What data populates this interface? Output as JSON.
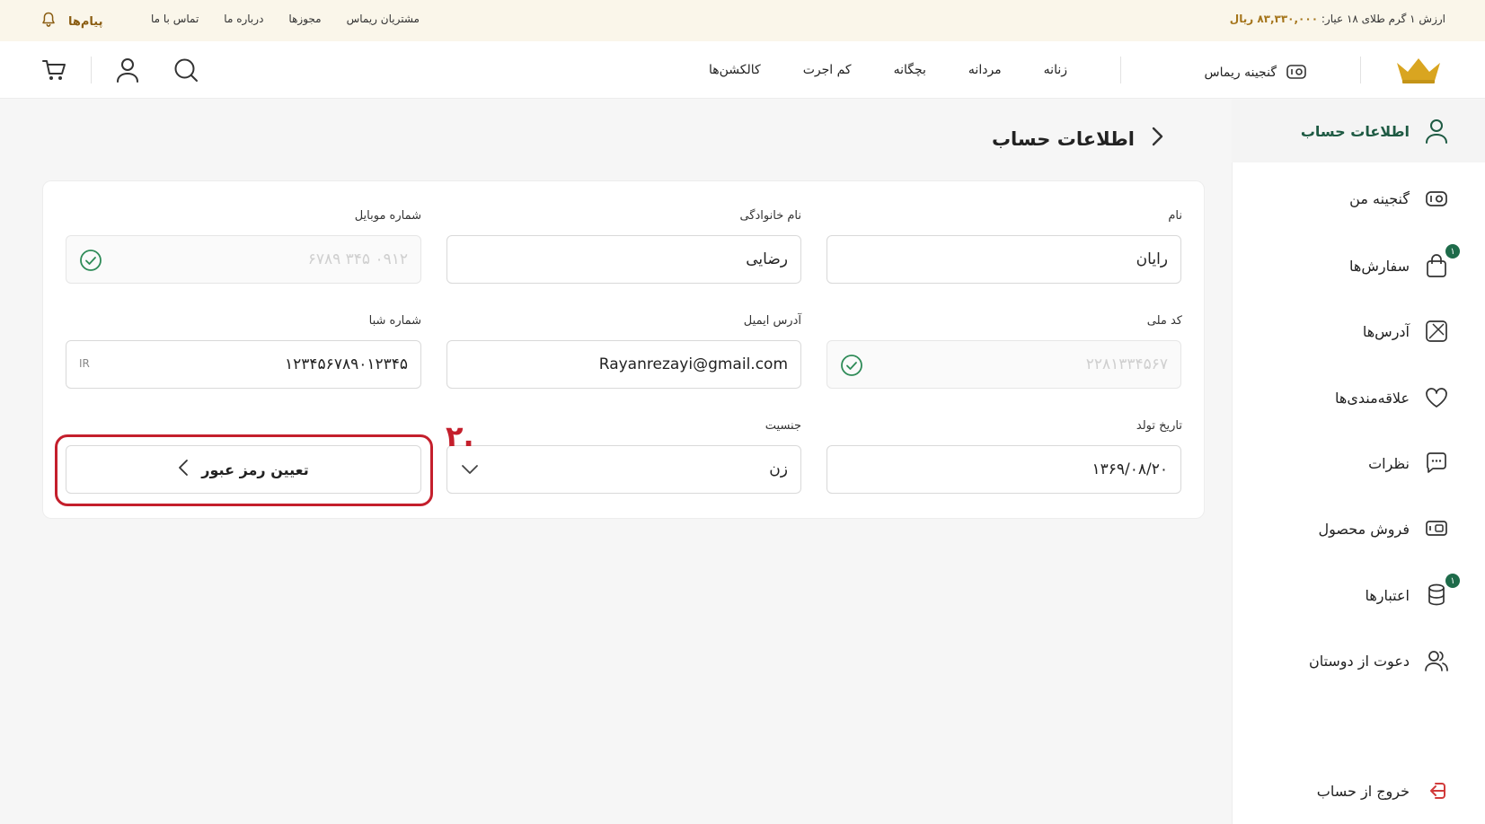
{
  "topbar": {
    "gold_label": "ارزش ۱ گرم طلای ۱۸ عیار:",
    "gold_value": "۸۳,۳۳۰,۰۰۰ ریال",
    "links": [
      "مشتریان ریماس",
      "مجوزها",
      "درباره ما",
      "تماس با ما"
    ],
    "messages_label": "پیام‌ها"
  },
  "header": {
    "brand_link": "گنجینه ریماس",
    "nav": [
      "زنانه",
      "مردانه",
      "بچگانه",
      "کم اجرت",
      "کالکشن‌ها"
    ]
  },
  "sidebar": {
    "items": [
      {
        "label": "اطلاعات حساب",
        "icon": "user-icon",
        "active": true
      },
      {
        "label": "گنجینه من",
        "icon": "treasure-icon"
      },
      {
        "label": "سفارش‌ها",
        "icon": "bag-icon",
        "badge": "۱"
      },
      {
        "label": "آدرس‌ها",
        "icon": "map-icon"
      },
      {
        "label": "علاقه‌مندی‌ها",
        "icon": "heart-icon"
      },
      {
        "label": "نظرات",
        "icon": "comment-icon"
      },
      {
        "label": "فروش محصول",
        "icon": "sell-icon"
      },
      {
        "label": "اعتبارها",
        "icon": "coins-icon",
        "badge": "۱"
      },
      {
        "label": "دعوت از دوستان",
        "icon": "users-icon"
      }
    ],
    "logout": "خروج از حساب"
  },
  "page": {
    "title": "اطلاعات حساب"
  },
  "form": {
    "first_name": {
      "label": "نام",
      "value": "رایان"
    },
    "last_name": {
      "label": "نام خانوادگی",
      "value": "رضایی"
    },
    "mobile": {
      "label": "شماره موبایل",
      "value": "۰۹۱۲ ۳۴۵ ۶۷۸۹"
    },
    "national_code": {
      "label": "کد ملی",
      "value": "۲۲۸۱۳۳۴۵۶۷"
    },
    "email": {
      "label": "آدرس ایمیل",
      "value": "Rayanrezayi@gmail.com"
    },
    "sheba": {
      "label": "شماره شبا",
      "value": "۱۲۳۴۵۶۷۸۹۰۱۲۳۴۵",
      "prefix": "IR"
    },
    "birth_date": {
      "label": "تاریخ تولد",
      "value": "۱۳۶۹/۰۸/۲۰"
    },
    "gender": {
      "label": "جنسیت",
      "value": "زن"
    },
    "password_button": "تعیین رمز عبور"
  },
  "annotation": {
    "step": ".۲",
    "color": "#c41f2c"
  },
  "colors": {
    "accent_green": "#1e5a43",
    "gold": "#d9a520",
    "check_green": "#2e8b57"
  }
}
